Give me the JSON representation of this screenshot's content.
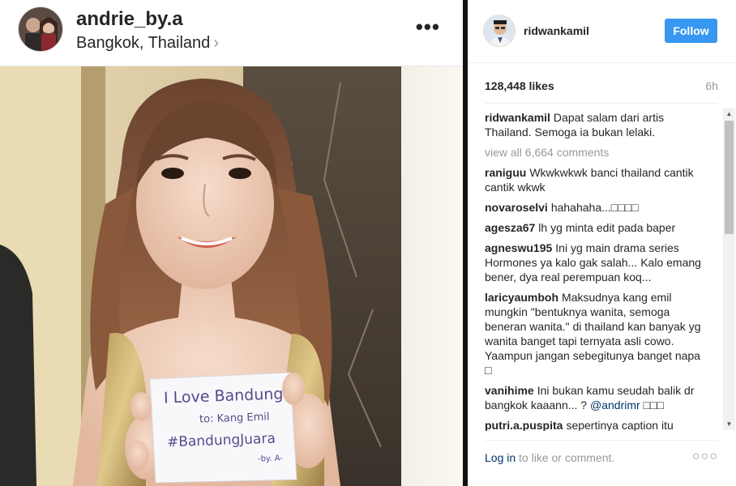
{
  "embedded_post": {
    "username": "andrie_by.a",
    "location": "Bangkok, Thailand",
    "location_chevron": "›",
    "more_icon": "•••",
    "note_lines": [
      "I Love Bandung",
      "to: Kang Emil",
      "#BandungJuara",
      "-by. A-"
    ]
  },
  "post": {
    "username": "ridwankamil",
    "follow_label": "Follow",
    "likes": "128,448 likes",
    "time": "6h",
    "caption_user": "ridwankamil",
    "caption_text": "Dapat salam dari artis Thailand. Semoga ia bukan lelaki.",
    "view_all": "view all 6,664 comments",
    "comments": [
      {
        "user": "raniguu",
        "text": "Wkwkwkwk banci thailand cantik cantik wkwk"
      },
      {
        "user": "novaroselvi",
        "text": "hahahaha...□□□□"
      },
      {
        "user": "agesza67",
        "text": "lh yg minta edit pada baper"
      },
      {
        "user": "agneswu195",
        "text": "Ini yg main drama series Hormones ya kalo gak salah... Kalo emang bener, dya real perempuan koq..."
      },
      {
        "user": "laricyaumboh",
        "text": "Maksudnya kang emil mungkin \"bentuknya wanita, semoga beneran wanita.\" di thailand kan banyak yg wanita banget tapi ternyata asli cowo. Yaampun jangan sebegitunya banget napa □"
      },
      {
        "user": "vanihime",
        "text": "Ini bukan kamu seudah balik dr bangkok kaaann... ?",
        "mention": "@andrimr",
        "tail": "□□□"
      },
      {
        "user": "putri.a.puspita",
        "text": "sepertinya caption itu"
      }
    ],
    "login_link": "Log in",
    "login_rest": "to like or comment.",
    "more_dots": "○○○"
  },
  "colors": {
    "follow_bg": "#3897f0",
    "link": "#003569",
    "muted": "#999999"
  }
}
